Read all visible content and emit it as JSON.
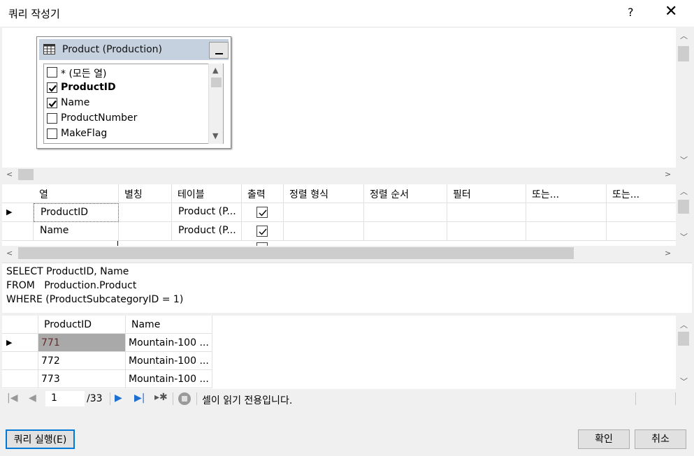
{
  "window": {
    "title": "쿼리 작성기",
    "help_label": "?",
    "close_label": "✕"
  },
  "diagram": {
    "table_title": "Product (Production)",
    "columns": [
      {
        "label": "* (모든 열)",
        "checked": false,
        "bold": false
      },
      {
        "label": "ProductID",
        "checked": true,
        "bold": true
      },
      {
        "label": "Name",
        "checked": true,
        "bold": false
      },
      {
        "label": "ProductNumber",
        "checked": false,
        "bold": false
      },
      {
        "label": "MakeFlag",
        "checked": false,
        "bold": false
      }
    ]
  },
  "criteria": {
    "headers": [
      "열",
      "별칭",
      "테이블",
      "출력",
      "정렬 형식",
      "정렬 순서",
      "필터",
      "또는...",
      "또는..."
    ],
    "rows": [
      {
        "column": "ProductID",
        "table": "Product (P...",
        "output": true
      },
      {
        "column": "Name",
        "table": "Product (P...",
        "output": true
      }
    ]
  },
  "sql": {
    "line1": "SELECT ProductID, Name",
    "line2": "FROM   Production.Product",
    "line3": "WHERE (ProductSubcategoryID = 1)"
  },
  "results": {
    "headers": [
      "ProductID",
      "Name"
    ],
    "rows": [
      {
        "id": "771",
        "name": "Mountain-100 ..."
      },
      {
        "id": "772",
        "name": "Mountain-100 ..."
      },
      {
        "id": "773",
        "name": "Mountain-100 ..."
      }
    ]
  },
  "nav": {
    "current_page": "1",
    "total": "/33",
    "status": "셀이 읽기 전용입니다."
  },
  "buttons": {
    "execute": "쿼리 실행(E)",
    "ok": "확인",
    "cancel": "취소"
  }
}
